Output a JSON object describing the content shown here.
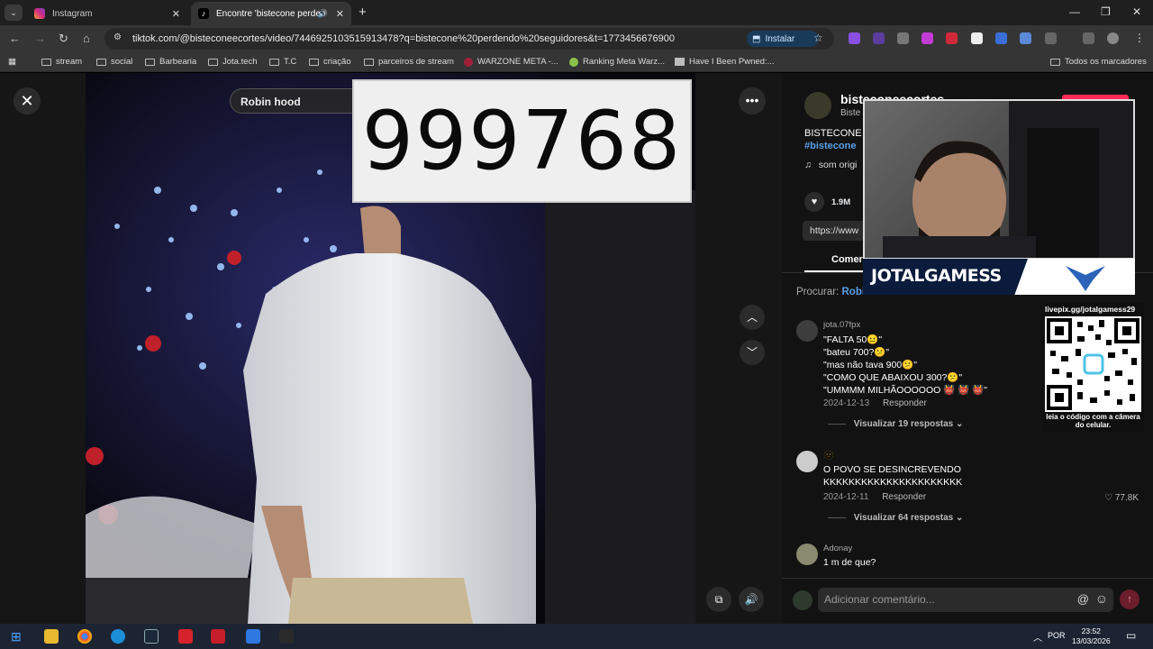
{
  "browser": {
    "tabs": [
      {
        "label": "Instagram"
      },
      {
        "label": "Encontre 'bistecone perden"
      }
    ],
    "url": "tiktok.com/@bisteconeecortes/video/7446925103515913478?q=bistecone%20perdendo%20seguidores&t=1773456676900",
    "install_label": "Instalar",
    "bookmarks": [
      "stream",
      "social",
      "Barbearia",
      "Jota.tech",
      "T.C",
      "criação",
      "parceiros de stream",
      "WARZONE META -...",
      "Ranking Meta Warz...",
      "Have I Been Pwned:...",
      "Todos os marcadores"
    ]
  },
  "video": {
    "search_text": "Robin hood",
    "counter": "999768"
  },
  "panel": {
    "username": "bisteconeecortes",
    "subname": "Biste",
    "description_line1": "BISTECONE",
    "hashtag": "#bistecone",
    "sound": "som origi",
    "likes": "1.9M",
    "link": "https://www",
    "tab_comments": "Comer",
    "search_prefix": "Procurar:",
    "search_term": "Robin hood",
    "comments": [
      {
        "user": "jota.07fpx",
        "lines": [
          "\"FALTA 50😐\"",
          "\"bateu 700?😕\"",
          "\"mas não tava 900😕\"",
          "\"COMO QUE ABAIXOU 300?😕\"",
          "\"UMMMM MILHÃOOOOOO 👹 👹 👹\""
        ],
        "date": "2024-12-13",
        "reply": "Responder",
        "replies": "Visualizar 19 respostas"
      },
      {
        "user": "🫥",
        "lines": [
          "O POVO SE DESINCREVENDO",
          "KKKKKKKKKKKKKKKKKKKKKK"
        ],
        "date": "2024-12-11",
        "reply": "Responder",
        "likes": "77.8K",
        "replies": "Visualizar 64 respostas"
      },
      {
        "user": "Adonay",
        "lines": [
          "1 m de que?"
        ]
      }
    ],
    "comment_placeholder": "Adicionar comentário..."
  },
  "overlay": {
    "brand": "JOTALGAMESS",
    "qr_url": "livepix.gg/jotalgamess29",
    "qr_caption": "leia o código com a câmera do celular."
  },
  "taskbar": {
    "lang": "POR",
    "time": "23:52",
    "date": "13/03/2026"
  },
  "colors": {
    "accent_red": "#fe2c55",
    "link_blue": "#5a9ee6",
    "brand_navy": "#0b1b3b"
  }
}
